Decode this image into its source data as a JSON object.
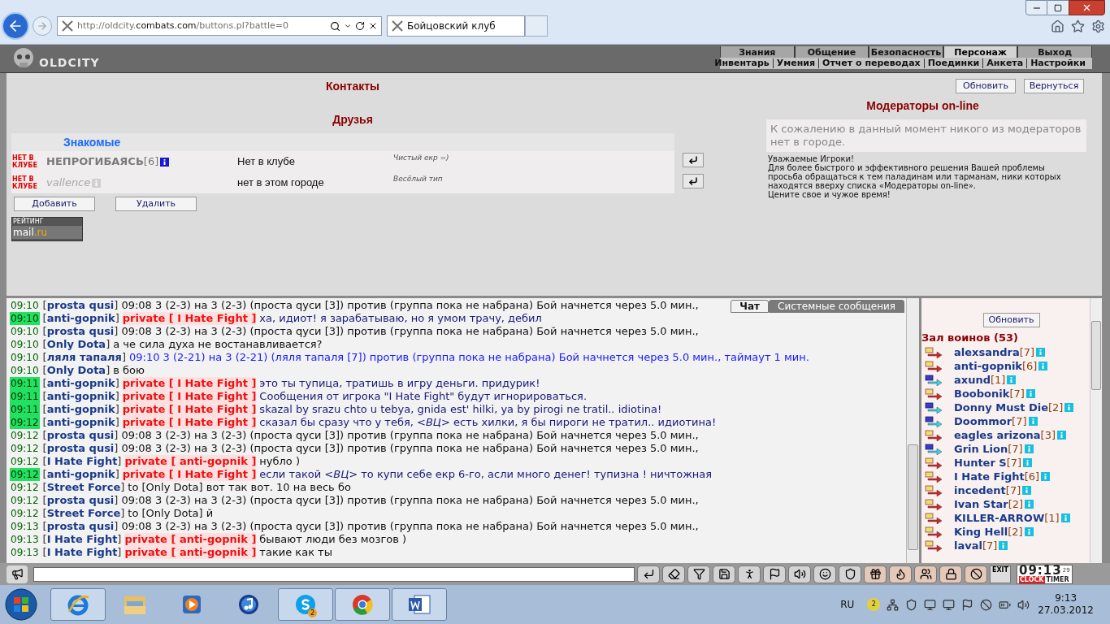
{
  "browser": {
    "url": "http://oldcity.**combats.com**/buttons.pl?battle=0",
    "tab_title": "Бойцовский клуб"
  },
  "game_header": {
    "logo": "OLDCITY",
    "menu": [
      {
        "label": "Знания",
        "selected": false
      },
      {
        "label": "Общение",
        "selected": false
      },
      {
        "label": "Безопасность",
        "selected": false
      },
      {
        "label": "Персонаж",
        "selected": true
      },
      {
        "label": "Выход",
        "selected": false
      }
    ],
    "submenu": [
      "Инвентарь",
      "Умения",
      "Отчет о переводах",
      "Поединки",
      "Анкета",
      "Настройки"
    ]
  },
  "contacts": {
    "title": "Контакты",
    "friends_title": "Друзья",
    "group_title": "Знакомые",
    "rows": [
      {
        "status": "НЕТ В КЛУБЕ",
        "name": "НЕПРОГИБАЯСЬ",
        "level": "[6]",
        "dimmed": false,
        "location": "Нет в клубе",
        "note": "Чистый екр =)"
      },
      {
        "status": "НЕТ В КЛУБЕ",
        "name": "vallence",
        "dimmed": true,
        "location": "нет в этом городе",
        "note": "Весёлый тип"
      }
    ],
    "buttons": [
      "Добавить",
      "Удалить"
    ],
    "rating": {
      "top": "РЕЙТИНГ",
      "bottom": "mail",
      "bottom_accent": ".ru"
    }
  },
  "moderators": {
    "buttons": [
      "Обновить",
      "Вернуться"
    ],
    "title": "Модераторы on-line",
    "notice": "К сожалению в данный момент никого из модераторов нет в городе.",
    "info": [
      "Уважаемые Игроки!",
      "Для более быстрого и эффективного решения Вашей проблемы",
      "просьба обращаться к тем паладинам или тарманам, ники которых",
      "находятся вверху списка «Модераторы on-line».",
      "Ценитe свое и чужое время!"
    ]
  },
  "chat": {
    "tabs": [
      {
        "label": "Чат",
        "selected": true
      },
      {
        "label": "Системные сообщения",
        "selected": false
      }
    ],
    "messages": [
      {
        "time": "09:10",
        "highlighted": false,
        "sender": "[**prosta qusi**]",
        "text": "09:08 3 (2-3) на 3 (2-3) (проста qуси [3]) против (группа пока не набрана) Бой начнется через 5.0 мин.,",
        "kind": "normal"
      },
      {
        "time": "09:10",
        "highlighted": true,
        "sender": "[**anti-gopnik**]",
        "private": "private [ I Hate Fight ]",
        "text": "ха, идиот! я зарабатываю, но я умом трачу, дебил",
        "kind": "private"
      },
      {
        "time": "09:10",
        "highlighted": false,
        "sender": "[**prosta qusi**]",
        "text": "09:08 3 (2-3) на 3 (2-3) (проста qуси [3]) против (группа пока не набрана) Бой начнется через 5.0 мин.,",
        "kind": "normal"
      },
      {
        "time": "09:10",
        "highlighted": false,
        "sender": "[**Only Dota**]",
        "text": "а че сила духа не востанавливается?",
        "kind": "normal"
      },
      {
        "time": "09:10",
        "highlighted": false,
        "sender": "[**ляля тапаля**]",
        "text": "09:10 3 (2-21) на 3 (2-21) (ляля тапаля [7]) против (группа пока не набрана) Бой начнется через 5.0 мин., таймаут 1 мин.",
        "kind": "system"
      },
      {
        "time": "09:10",
        "highlighted": false,
        "sender": "[**Only Dota**]",
        "text": "в бою",
        "kind": "normal"
      },
      {
        "time": "09:11",
        "highlighted": true,
        "sender": "[**anti-gopnik**]",
        "private": "private [ I Hate Fight ]",
        "text": "это ты тупица, тратишь в игру деньги. придурик!",
        "kind": "private"
      },
      {
        "time": "09:11",
        "highlighted": true,
        "sender": "[**anti-gopnik**]",
        "private": "private [ I Hate Fight ]",
        "text": "Сообщения от игрока \"I Hate Fight\" будут игнорироваться.",
        "kind": "private"
      },
      {
        "time": "09:11",
        "highlighted": true,
        "sender": "[**anti-gopnik**]",
        "private": "private [ I Hate Fight ]",
        "text": "skazal by srazu chto u tebya, gnida est' hilki, ya by pirogi ne tratil.. idiotina!",
        "kind": "private"
      },
      {
        "time": "09:12",
        "highlighted": true,
        "sender": "[**anti-gopnik**]",
        "private": "private [ I Hate Fight ]",
        "text": "сказал бы сразу что у тебя, *<ВЦ>* есть хилки, я бы пироги не тратил.. идиотина!",
        "kind": "private"
      },
      {
        "time": "09:12",
        "highlighted": false,
        "sender": "[**prosta qusi**]",
        "text": "09:08 3 (2-3) на 3 (2-3) (проста qуси [3]) против (группа пока не набрана) Бой начнется через 5.0 мин.,",
        "kind": "normal"
      },
      {
        "time": "09:12",
        "highlighted": false,
        "sender": "[**prosta qusi**]",
        "text": "09:08 3 (2-3) на 3 (2-3) (проста qуси [3]) против (группа пока не набрана) Бой начнется через 5.0 мин.,",
        "kind": "normal"
      },
      {
        "time": "09:12",
        "highlighted": false,
        "sender": "[**I Hate Fight**]",
        "private": "private [ anti-gopnik ]",
        "text": "нубло )",
        "kind": "normal"
      },
      {
        "time": "09:12",
        "highlighted": true,
        "sender": "[**anti-gopnik**]",
        "private": "private [ I Hate Fight ]",
        "text": "если такой *<ВЦ>* то купи себе екр 6-го, асли много денег! тупизна ! ничтожная",
        "kind": "private"
      },
      {
        "time": "09:12",
        "highlighted": false,
        "sender": "[**Street Force**]",
        "text": "to [Only Dota] вот так вот. 10 на весь бо",
        "kind": "normal"
      },
      {
        "time": "09:12",
        "highlighted": false,
        "sender": "[**prosta qusi**]",
        "text": "09:08 3 (2-3) на 3 (2-3) (проста qуси [3]) против (группа пока не набрана) Бой начнется через 5.0 мин.,",
        "kind": "normal"
      },
      {
        "time": "09:12",
        "highlighted": false,
        "sender": "[**Street Force**]",
        "text": "to [Only Dota] й",
        "kind": "normal"
      },
      {
        "time": "09:13",
        "highlighted": false,
        "sender": "[**prosta qusi**]",
        "text": "09:08 3 (2-3) на 3 (2-3) (проста qуси [3]) против (группа пока не набрана) Бой начнется через 5.0 мин.,",
        "kind": "normal"
      },
      {
        "time": "09:13",
        "highlighted": false,
        "sender": "[**I Hate Fight**]",
        "private": "private [ anti-gopnik ]",
        "text": "бывают люди без мозгов )",
        "kind": "normal"
      },
      {
        "time": "09:13",
        "highlighted": false,
        "sender": "[**I Hate Fight**]",
        "private": "private [ anti-gopnik ]",
        "text": "такие как ты",
        "kind": "normal"
      }
    ]
  },
  "warriors": {
    "refresh": "Обновить",
    "title": "Зал воинов (53)",
    "players": [
      {
        "name": "alexsandra",
        "level": "[7]",
        "kind": "warm"
      },
      {
        "name": "anti-gopnik",
        "level": "[6]",
        "kind": "warm"
      },
      {
        "name": "axund",
        "level": "[1]",
        "kind": "cool"
      },
      {
        "name": "Boobonik",
        "level": "[7]",
        "kind": "warm"
      },
      {
        "name": "Donny Must Die",
        "level": "[2]",
        "kind": "cool"
      },
      {
        "name": "Doommor",
        "level": "[7]",
        "kind": "cool"
      },
      {
        "name": "eagles arizona",
        "level": "[3]",
        "kind": "warm"
      },
      {
        "name": "Grin Lion",
        "level": "[7]",
        "kind": "cool"
      },
      {
        "name": "Hunter S",
        "level": "[7]",
        "kind": "warm"
      },
      {
        "name": "I Hate Fight",
        "level": "[6]",
        "kind": "warm"
      },
      {
        "name": "incedent",
        "level": "[7]",
        "kind": "warm"
      },
      {
        "name": "Ivan Star",
        "level": "[2]",
        "kind": "warm"
      },
      {
        "name": "KILLER-ARROW",
        "level": "[1]",
        "kind": "warm"
      },
      {
        "name": "King Hell",
        "level": "[2]",
        "kind": "warm"
      },
      {
        "name": "laval",
        "level": "[7]",
        "kind": "warm"
      }
    ]
  },
  "toolbar": {
    "exit_label": "EXIT",
    "clock": "09:13",
    "seconds": "29",
    "clock_label": "CLOCK",
    "timer_label": "TIMER"
  },
  "taskbar": {
    "apps": [
      {
        "kind": "ie",
        "running": true
      },
      {
        "kind": "explorer",
        "running": false
      },
      {
        "kind": "media",
        "running": false
      },
      {
        "kind": "music",
        "running": false
      },
      {
        "kind": "skype",
        "running": true,
        "badge": "2"
      },
      {
        "kind": "chrome",
        "running": true
      },
      {
        "kind": "word",
        "running": true
      }
    ],
    "language": "RU",
    "tray_badge": "2",
    "time": "9:13",
    "date": "27.03.2012"
  }
}
